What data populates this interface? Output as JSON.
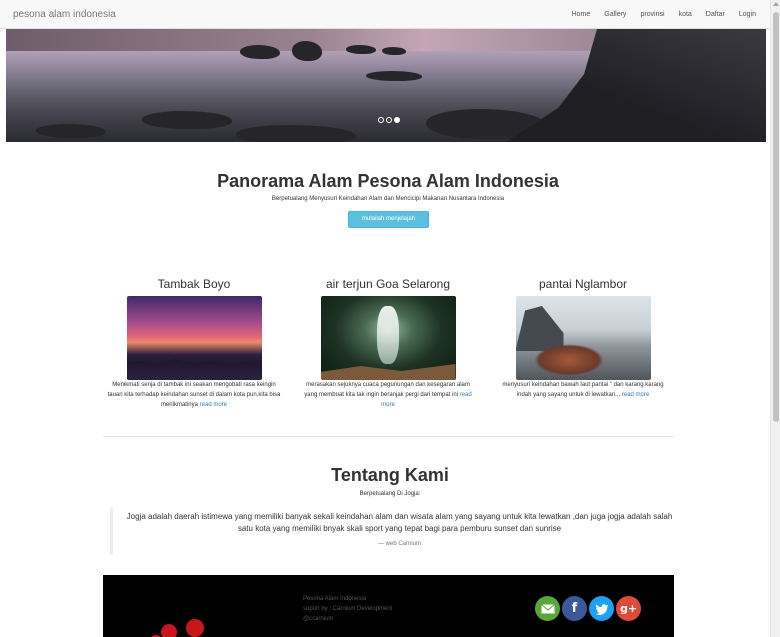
{
  "navbar": {
    "brand": "pesona alam indonesia",
    "links": [
      "Home",
      "Gallery",
      "provinsi",
      "kota",
      "Daftar",
      "Login"
    ]
  },
  "carousel": {
    "indicators": 3,
    "active_index": 2
  },
  "intro": {
    "title": "Panorama Alam Pesona Alam Indonesia",
    "subtitle": "Berpetualang Menyusuri Keindahan Alam dan Mencicipi Makanan Nusantara Indonesia",
    "button": "mulailah menjelajah"
  },
  "cards": [
    {
      "title": "Tambak Boyo",
      "desc": "Menikmati senja di tambak ini seakan mengobati rasa keingin tauan kita terhadap keindahan sunset di dalam kota pun,kita bisa menikmatinya",
      "link": "read more"
    },
    {
      "title": "air terjun Goa Selarong",
      "desc": "merasakan sejuknya cuaca pegunungan dan kesegaran alam yang membuat kita tak ingin beranjak pergi dari tempat ini",
      "link": "read more"
    },
    {
      "title": "pantai Nglambor",
      "desc": "menyusuri keindahan bawah laut pantai \" dan karang karang indah yang sayang untuk di lewatkan...",
      "link": "read more"
    }
  ],
  "about": {
    "title": "Tentang Kami",
    "subtitle": "Berpetualang Di Jogja:",
    "quote": "Jogja adalah daerah istimewa yang memiliki banyak sekali keindahan alam dan wisata alam yang sayang untuk kita lewatkan ,dan juga jogja adalah salah satu kota yang memiliki bnyak skali sport yang tepat bagi para pemburu sunset dan sunrise",
    "quote_source": "— web Carnium"
  },
  "footer": {
    "lines": [
      "Pesona Alam Indonesia",
      "suport by : Carnium Development",
      "@ccarnium"
    ],
    "social": [
      "mail-icon",
      "facebook-icon",
      "twitter-icon",
      "google-plus-icon"
    ]
  },
  "colors": {
    "info_button": "#5bc0de",
    "link": "#337ab7"
  }
}
